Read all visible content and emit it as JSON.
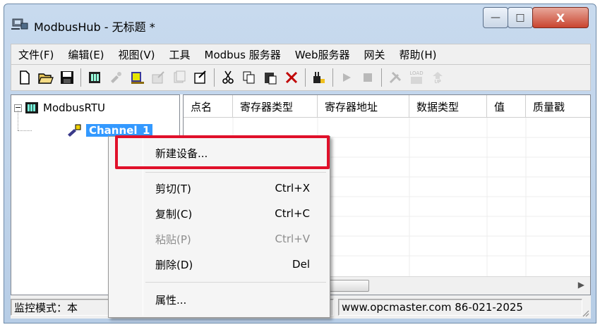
{
  "window": {
    "title": "ModbusHub - 无标题 *",
    "controls": {
      "minimize": "—",
      "maximize": "□",
      "close": "X"
    }
  },
  "menubar": {
    "items": [
      "文件(F)",
      "编辑(E)",
      "视图(V)",
      "工具",
      "Modbus 服务器",
      "Web服务器",
      "网关",
      "帮助(H)"
    ]
  },
  "toolbar": {
    "buttons": [
      {
        "icon": "new-file-icon",
        "enabled": true
      },
      {
        "icon": "open-folder-icon",
        "enabled": true
      },
      {
        "icon": "save-disk-icon",
        "enabled": true
      },
      {
        "icon": "new-device-icon",
        "enabled": true
      },
      {
        "icon": "new-channel-icon",
        "enabled": false
      },
      {
        "icon": "new-point-icon",
        "enabled": true
      },
      {
        "icon": "edit-icon",
        "enabled": false
      },
      {
        "icon": "batch-icon",
        "enabled": false
      },
      {
        "icon": "properties-icon",
        "enabled": true
      },
      {
        "icon": "cut-icon",
        "enabled": true
      },
      {
        "icon": "copy-icon",
        "enabled": true
      },
      {
        "icon": "paste-icon",
        "enabled": true
      },
      {
        "icon": "delete-icon",
        "enabled": true
      },
      {
        "icon": "wizard-icon",
        "enabled": true
      },
      {
        "icon": "run-icon",
        "enabled": false
      },
      {
        "icon": "stop-icon",
        "enabled": false
      },
      {
        "icon": "tools-icon",
        "enabled": false
      },
      {
        "icon": "load-icon",
        "enabled": false
      },
      {
        "icon": "upload-icon",
        "enabled": false
      }
    ],
    "load_text": "LOAD",
    "up_text": "UP"
  },
  "tree": {
    "root_label": "ModbusRTU",
    "expander": "−",
    "child_label": "Channel_1"
  },
  "grid": {
    "columns": [
      "点名",
      "寄存器类型",
      "寄存器地址",
      "数据类型",
      "值",
      "质量戳"
    ]
  },
  "context_menu": {
    "items": [
      {
        "label": "新建设备...",
        "shortcut": "",
        "enabled": true
      },
      {
        "label": "剪切(T)",
        "shortcut": "Ctrl+X",
        "enabled": true
      },
      {
        "label": "复制(C)",
        "shortcut": "Ctrl+C",
        "enabled": true
      },
      {
        "label": "粘贴(P)",
        "shortcut": "Ctrl+V",
        "enabled": false
      },
      {
        "label": "删除(D)",
        "shortcut": "Del",
        "enabled": true
      },
      {
        "label": "属性...",
        "shortcut": "",
        "enabled": true
      }
    ]
  },
  "statusbar": {
    "left": "监控模式：本",
    "right": "www.opcmaster.com 86-021-2025"
  },
  "colors": {
    "highlight_border": "#e0102a",
    "selection": "#3399ff",
    "close_button": "#c9442f"
  }
}
